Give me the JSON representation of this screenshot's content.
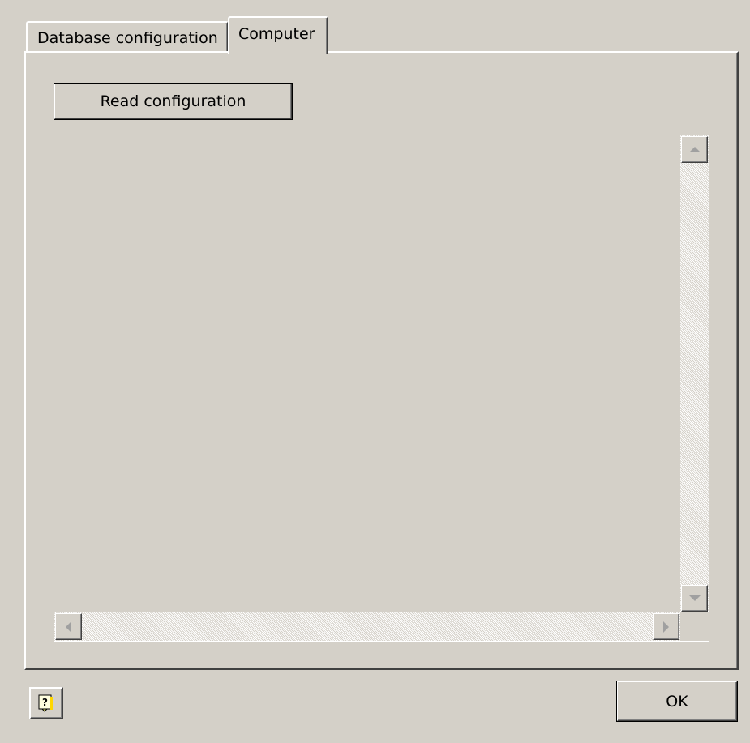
{
  "tabs": [
    {
      "label": "Database configuration",
      "active": false
    },
    {
      "label": "Computer",
      "active": true
    }
  ],
  "panel": {
    "read_button_label": "Read configuration",
    "list_empty": true
  },
  "footer": {
    "help_icon": "help-icon",
    "ok_label": "OK"
  },
  "colors": {
    "face": "#d4d0c8",
    "highlight": "#ffffff",
    "shadow": "#808080",
    "dark_shadow": "#404040"
  }
}
